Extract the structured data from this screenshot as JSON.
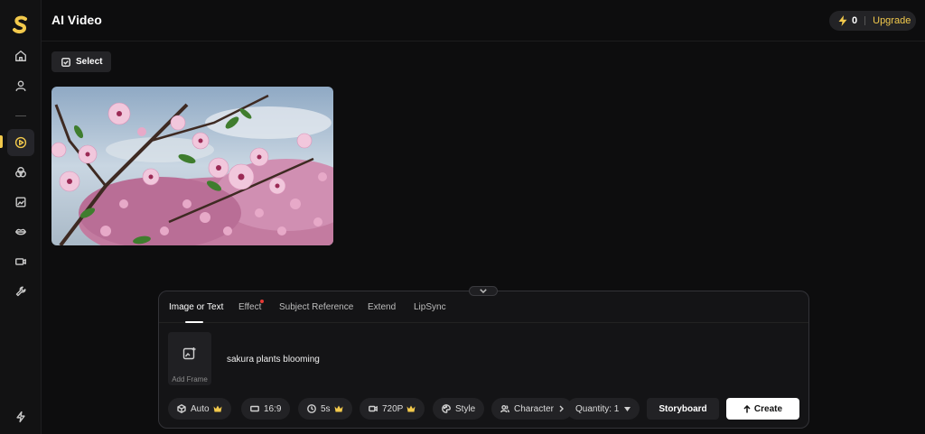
{
  "header": {
    "title": "AI Video",
    "credits": "0",
    "upgrade_label": "Upgrade"
  },
  "toolbar": {
    "select_label": "Select"
  },
  "sidebar": {
    "items": [
      {
        "icon": "home-icon"
      },
      {
        "icon": "user-icon"
      },
      {
        "icon": "video-play-icon",
        "active": true
      },
      {
        "icon": "effects-icon"
      },
      {
        "icon": "image-icon"
      },
      {
        "icon": "lips-icon"
      },
      {
        "icon": "camera-icon"
      },
      {
        "icon": "wrench-icon"
      },
      {
        "icon": "bolt-icon"
      }
    ]
  },
  "media": {
    "description_icon": "image-thumbnail"
  },
  "panel": {
    "tabs": [
      {
        "label": "Image or Text",
        "active": true
      },
      {
        "label": "Effect",
        "dot": true
      },
      {
        "label": "Subject Reference"
      },
      {
        "label": "Extend"
      },
      {
        "label": "LipSync"
      }
    ],
    "add_frame_label": "Add Frame",
    "prompt": "sakura plants blooming",
    "options": {
      "model": "Auto",
      "ratio": "16:9",
      "duration": "5s",
      "resolution": "720P",
      "style": "Style",
      "character": "Character",
      "quantity": "Quantity: 1"
    },
    "storyboard_label": "Storyboard",
    "create_label": "Create"
  },
  "colors": {
    "accent": "#f2c94c",
    "background": "#0d0d0e",
    "panel": "#141416",
    "badge_dot": "#e53935"
  }
}
